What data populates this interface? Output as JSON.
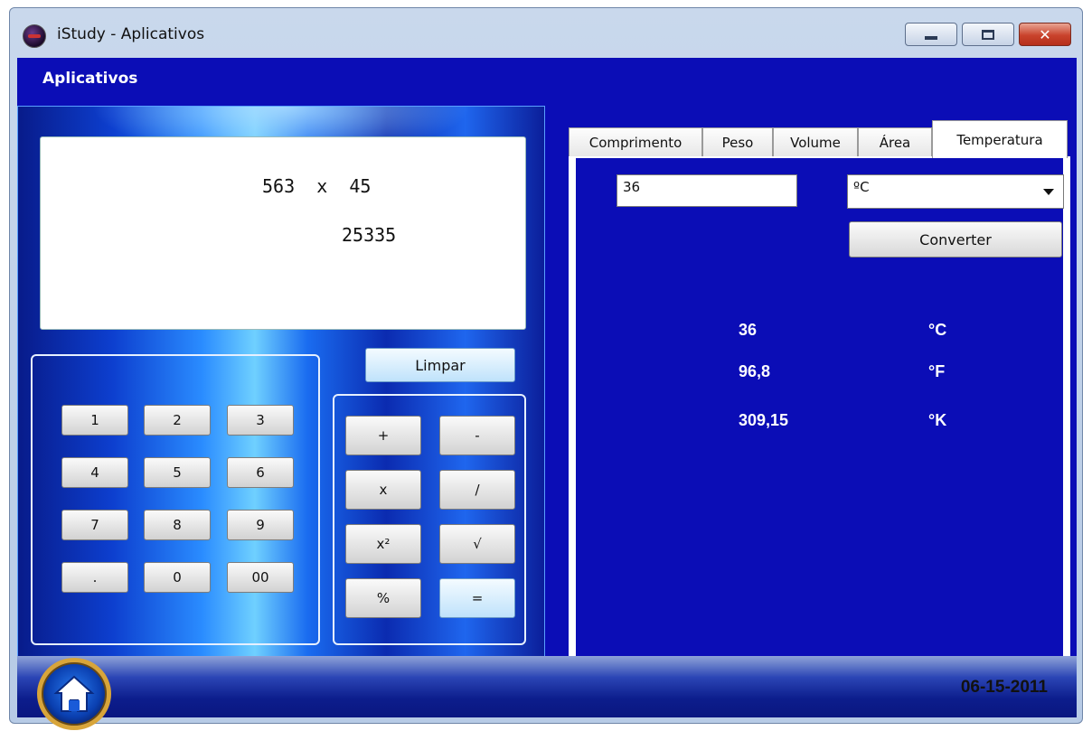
{
  "window": {
    "title": "iStudy - Aplicativos",
    "close_label": "✕"
  },
  "header": {
    "title": "Aplicativos"
  },
  "calculator": {
    "display": {
      "expression": "563  x  45",
      "result": "25335"
    },
    "clear_label": "Limpar",
    "number_keys": [
      "1",
      "2",
      "3",
      "4",
      "5",
      "6",
      "7",
      "8",
      "9",
      ".",
      "0",
      "00"
    ],
    "operator_keys": [
      "+",
      "-",
      "x",
      "/",
      "x²",
      "√",
      "%",
      "="
    ]
  },
  "converter": {
    "tabs": [
      "Comprimento",
      "Peso",
      "Volume",
      "Área",
      "Temperatura"
    ],
    "active_tab": "Temperatura",
    "input_value": "36",
    "selected_unit": "ºC",
    "convert_label": "Converter",
    "results": [
      {
        "value": "36",
        "unit": "°C"
      },
      {
        "value": "96,8",
        "unit": "°F"
      },
      {
        "value": "309,15",
        "unit": "°K"
      }
    ]
  },
  "footer": {
    "date": "06-15-2011"
  },
  "colors": {
    "client_background": "#0b0db6",
    "frame": "#b7cbe6",
    "close_button": "#c9432c"
  }
}
